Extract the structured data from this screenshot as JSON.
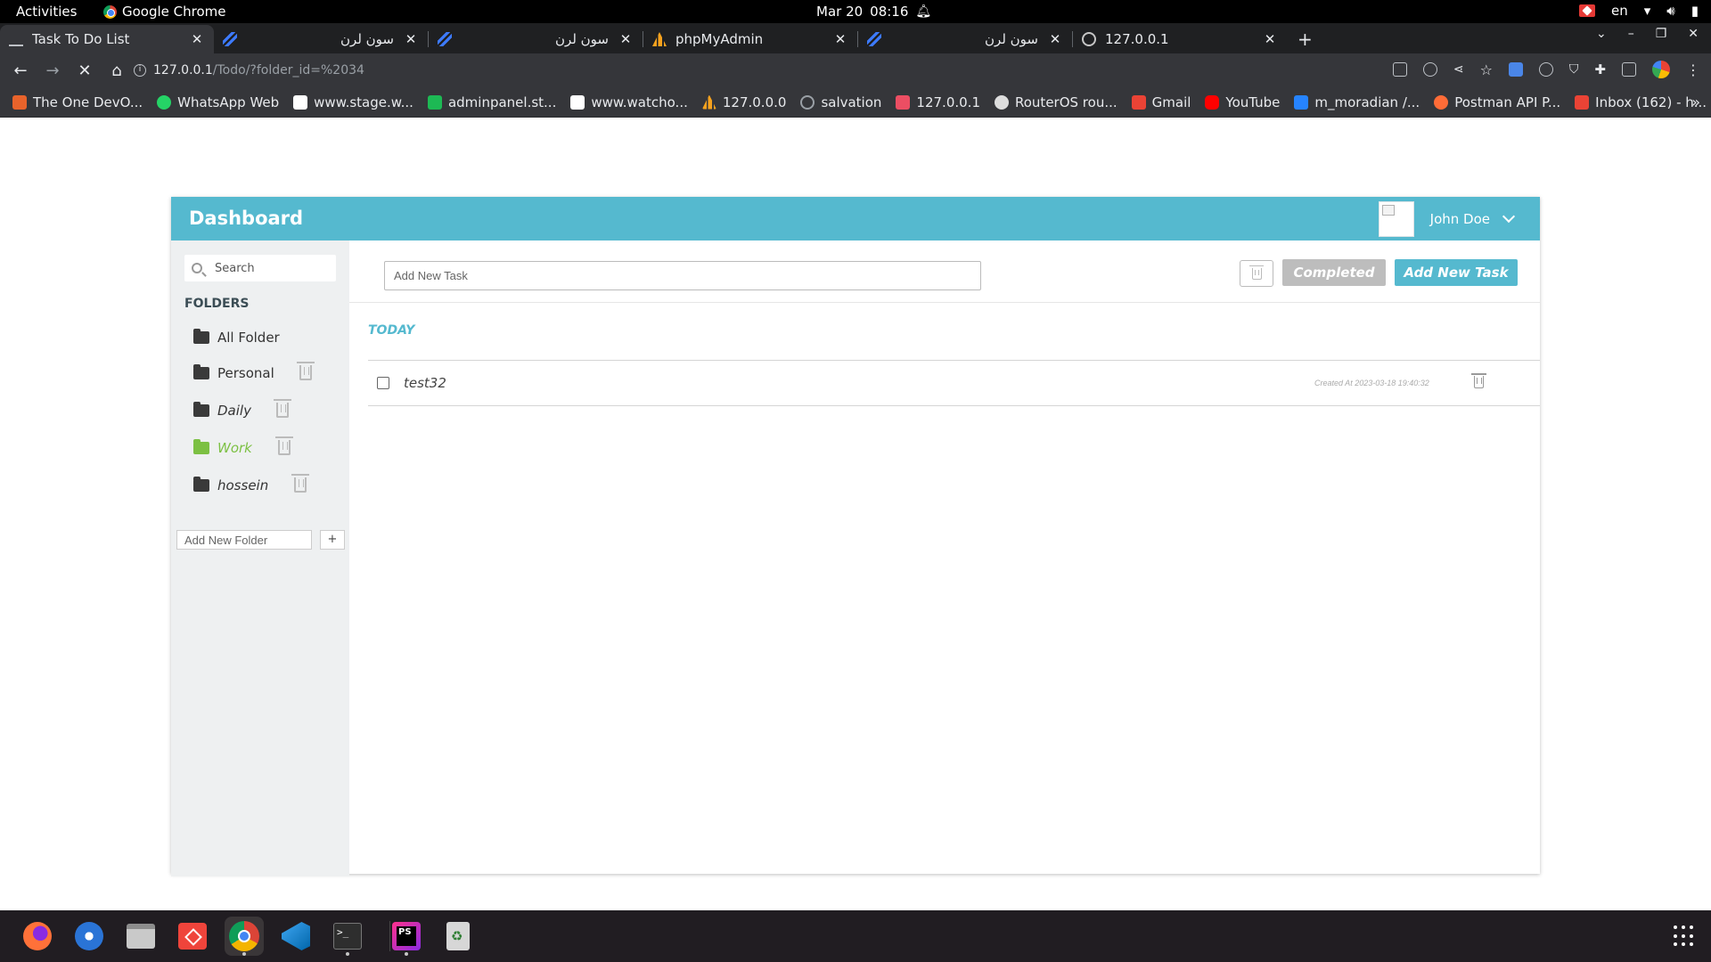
{
  "system": {
    "activities": "Activities",
    "app_name": "Google Chrome",
    "date": "Mar 20",
    "time": "08:16",
    "lang": "en"
  },
  "tabs": [
    {
      "title": "Task To Do List",
      "icon": "pen-icon"
    },
    {
      "title": "سون لرن",
      "icon": "sevenlearn-icon"
    },
    {
      "title": "سون لرن",
      "icon": "sevenlearn-icon"
    },
    {
      "title": "phpMyAdmin",
      "icon": "phpmyadmin-icon"
    },
    {
      "title": "سون لرن",
      "icon": "sevenlearn-icon"
    },
    {
      "title": "127.0.0.1",
      "icon": "globe-icon"
    }
  ],
  "address": {
    "host": "127.0.0.1",
    "path": "/Todo/?folder_id=%2034"
  },
  "bookmarks": [
    {
      "label": "The One DevO...",
      "color": "#e8632b"
    },
    {
      "label": "WhatsApp Web",
      "color": "#25d366"
    },
    {
      "label": "www.stage.w...",
      "color": "#ffffff"
    },
    {
      "label": "adminpanel.st...",
      "color": "#1db954"
    },
    {
      "label": "www.watcho...",
      "color": "#ffffff"
    },
    {
      "label": "127.0.0.0",
      "color": "#f6a21e"
    },
    {
      "label": "salvation",
      "color": "#9aa0a6"
    },
    {
      "label": "127.0.0.1",
      "color": "#ec4e63"
    },
    {
      "label": "RouterOS rou...",
      "color": "#dddddd"
    },
    {
      "label": "Gmail",
      "color": "#ea4335"
    },
    {
      "label": "YouTube",
      "color": "#ff0000"
    },
    {
      "label": "m_moradian /...",
      "color": "#2684ff"
    },
    {
      "label": "Postman API P...",
      "color": "#ff6c37"
    },
    {
      "label": "Inbox (162) - h...",
      "color": "#ea4335"
    }
  ],
  "app": {
    "title": "Dashboard",
    "user_name": "John Doe",
    "accent": "#55b9cf"
  },
  "sidebar": {
    "search_placeholder": "Search",
    "folders_heading": "FOLDERS",
    "folders": [
      {
        "label": "All Folder",
        "deletable": false,
        "active": false
      },
      {
        "label": "Personal",
        "deletable": true,
        "active": false
      },
      {
        "label": "Daily",
        "deletable": true,
        "active": false
      },
      {
        "label": "Work",
        "deletable": true,
        "active": true
      },
      {
        "label": "hossein",
        "deletable": true,
        "active": false
      }
    ],
    "add_folder_placeholder": "Add New Folder",
    "add_folder_button": "+"
  },
  "main": {
    "task_placeholder": "Add New Task",
    "completed_button": "Completed",
    "add_task_button": "Add New Task",
    "section_heading": "TODAY",
    "tasks": [
      {
        "name": "test32",
        "created": "Created At 2023-03-18 19:40:32",
        "done": false
      }
    ]
  }
}
